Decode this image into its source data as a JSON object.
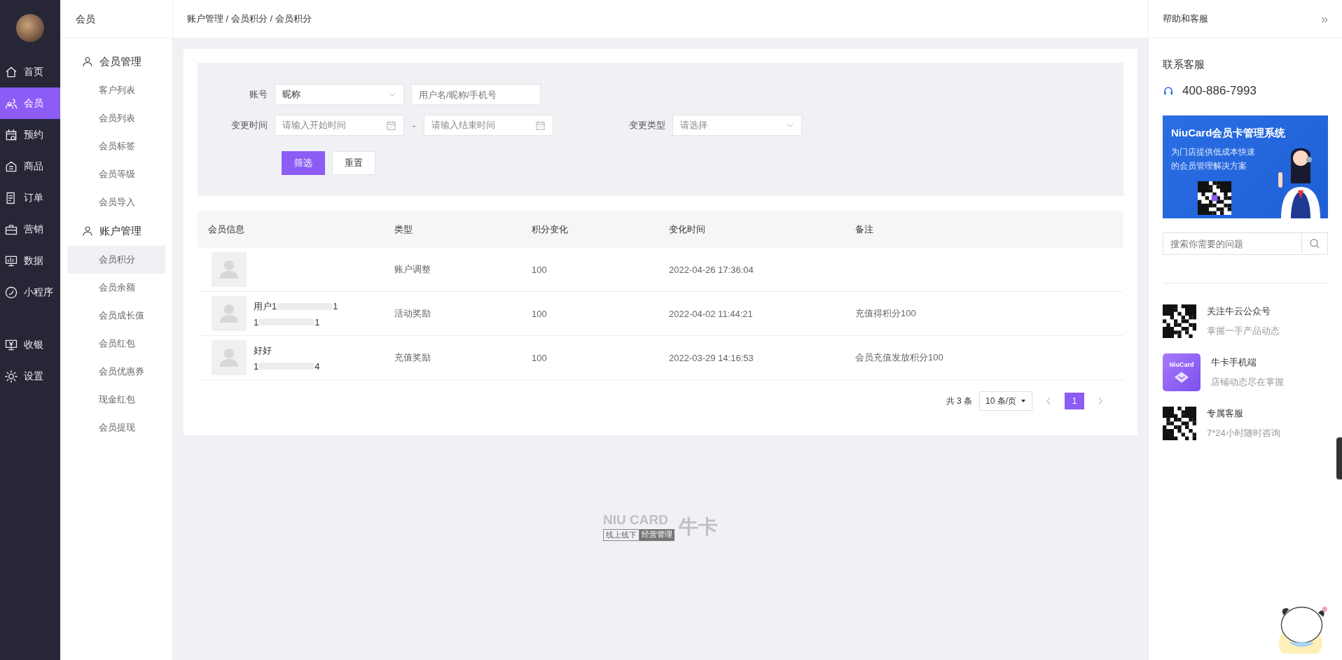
{
  "nav": [
    {
      "label": "首页",
      "selected": false
    },
    {
      "label": "会员",
      "selected": true
    },
    {
      "label": "预约",
      "selected": false
    },
    {
      "label": "商品",
      "selected": false
    },
    {
      "label": "订单",
      "selected": false
    },
    {
      "label": "营销",
      "selected": false
    },
    {
      "label": "数据",
      "selected": false
    },
    {
      "label": "小程序",
      "selected": false
    },
    {
      "label": "收银",
      "selected": false
    },
    {
      "label": "设置",
      "selected": false
    }
  ],
  "submenu": {
    "title": "会员",
    "groups": [
      {
        "label": "会员管理",
        "items": [
          {
            "label": "客户列表",
            "selected": false
          },
          {
            "label": "会员列表",
            "selected": false
          },
          {
            "label": "会员标签",
            "selected": false
          },
          {
            "label": "会员等级",
            "selected": false
          },
          {
            "label": "会员导入",
            "selected": false
          }
        ]
      },
      {
        "label": "账户管理",
        "items": [
          {
            "label": "会员积分",
            "selected": true
          },
          {
            "label": "会员余额",
            "selected": false
          },
          {
            "label": "会员成长值",
            "selected": false
          },
          {
            "label": "会员红包",
            "selected": false
          },
          {
            "label": "会员优惠券",
            "selected": false
          },
          {
            "label": "现金红包",
            "selected": false
          },
          {
            "label": "会员提现",
            "selected": false
          }
        ]
      }
    ]
  },
  "breadcrumb": "账户管理 / 会员积分 / 会员积分",
  "filter": {
    "account_label": "账号",
    "account_type": "昵称",
    "account_placeholder": "用户名/昵称/手机号",
    "time_label": "变更时间",
    "start_placeholder": "请输入开始时间",
    "separator": "-",
    "end_placeholder": "请输入结束时间",
    "type_label": "变更类型",
    "type_placeholder": "请选择",
    "buttons": [
      "筛选",
      "重置"
    ]
  },
  "table": {
    "columns": [
      "会员信息",
      "类型",
      "积分变化",
      "变化时间",
      "备注"
    ],
    "rows": [
      {
        "name": "",
        "name_end": "",
        "phone": "",
        "phone_end": "",
        "type": "账户调整",
        "change": "100",
        "time": "2022-04-26 17:36:04",
        "note": ""
      },
      {
        "name": "用户1",
        "name_end": "1",
        "phone": "1",
        "phone_end": "1",
        "type": "活动奖励",
        "change": "100",
        "time": "2022-04-02 11:44:21",
        "note": "充值得积分100"
      },
      {
        "name": "好好",
        "name_end": "",
        "phone": "1",
        "phone_end": "4",
        "type": "充值奖励",
        "change": "100",
        "time": "2022-03-29 14:16:53",
        "note": "会员充值发放积分100"
      }
    ]
  },
  "pagination": {
    "total": "共 3 条",
    "page_size": "10 条/页",
    "pages": [
      {
        "label": "1",
        "selected": true
      }
    ]
  },
  "footer_logo": {
    "brand": "NIU CARD",
    "tag_left": "线上线下",
    "tag_right": "经营管理",
    "name": "牛卡"
  },
  "help": {
    "title": "帮助和客服",
    "collapse": "»",
    "contact_title": "联系客服",
    "phone": "400-886-7993",
    "banner": {
      "title": "NiuCard会员卡管理系统",
      "lines": [
        "为门店提供低成本快速",
        "的会员管理解决方案"
      ]
    },
    "search_placeholder": "搜索你需要的问题",
    "links": [
      {
        "kind": "qr",
        "title": "关注牛云公众号",
        "subtitle": "掌握一手产品动态"
      },
      {
        "kind": "app",
        "app_label": "NiuCard",
        "title": "牛卡手机端",
        "subtitle": "店铺动态尽在掌握"
      },
      {
        "kind": "qr",
        "title": "专属客服",
        "subtitle": "7*24小时随时咨询"
      }
    ]
  }
}
